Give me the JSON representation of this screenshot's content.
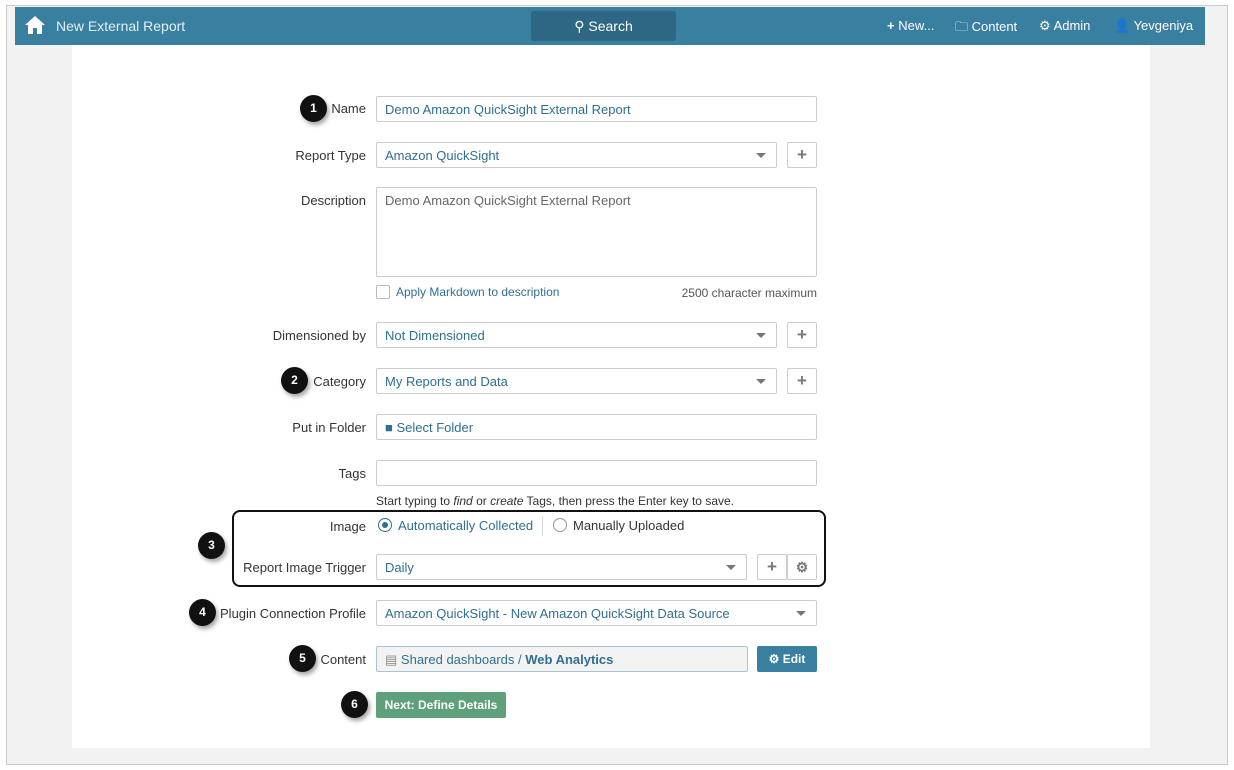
{
  "nav": {
    "title": "New External Report",
    "search": "Search",
    "new": "New...",
    "content": "Content",
    "admin": "Admin",
    "user": "Yevgeniya"
  },
  "form": {
    "name_label": "Name",
    "name_value": "Demo Amazon QuickSight External Report",
    "report_type_label": "Report Type",
    "report_type_value": "Amazon QuickSight",
    "description_label": "Description",
    "description_value": "Demo Amazon QuickSight External Report",
    "markdown_label": "Apply Markdown to description",
    "char_max": "2500 character maximum",
    "dimensioned_label": "Dimensioned by",
    "dimensioned_value": "Not Dimensioned",
    "category_label": "Category",
    "category_value": "My Reports and Data",
    "folder_label": "Put in Folder",
    "folder_value": "Select Folder",
    "tags_label": "Tags",
    "tags_value": "",
    "tags_help_1": "Start typing to ",
    "tags_help_find": "find",
    "tags_help_2": " or ",
    "tags_help_create": "create",
    "tags_help_3": " Tags, then press the Enter key to save.",
    "image_label": "Image",
    "image_auto": "Automatically Collected",
    "image_manual": "Manually Uploaded",
    "trigger_label": "Report Image Trigger",
    "trigger_value": "Daily",
    "plugin_label": "Plugin Connection Profile",
    "plugin_value": "Amazon QuickSight - New Amazon QuickSight Data Source",
    "content_label": "Content",
    "content_path": "Shared dashboards / ",
    "content_name": "Web Analytics",
    "edit": "Edit",
    "next": "Next: Define Details"
  },
  "badges": [
    "1",
    "2",
    "3",
    "4",
    "5",
    "6"
  ]
}
